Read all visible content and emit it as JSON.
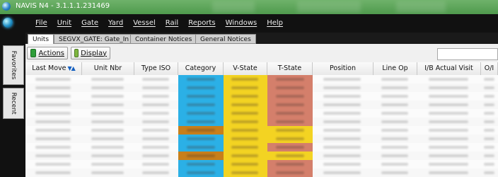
{
  "window": {
    "title": "NAVIS N4 - 3.1.1.1.231469"
  },
  "menu": [
    "File",
    "Unit",
    "Gate",
    "Yard",
    "Vessel",
    "Rail",
    "Reports",
    "Windows",
    "Help"
  ],
  "tabs": [
    "Units",
    "SEGVX_GATE: Gate_In",
    "Container Notices",
    "General Notices"
  ],
  "active_tab": "Units",
  "side_tabs": [
    "Favorites",
    "Recent"
  ],
  "toolbar": {
    "actions_label": "Actions",
    "display_label": "Display",
    "search_value": ""
  },
  "grid": {
    "columns": [
      "Last Move",
      "Unit Nbr",
      "Type ISO",
      "Category",
      "V-State",
      "T-State",
      "Position",
      "Line Op",
      "I/B Actual Visit",
      "O/I"
    ],
    "row_count": 12,
    "category_colors": [
      "#2bb0e6",
      "#2bb0e6",
      "#2bb0e6",
      "#2bb0e6",
      "#2bb0e6",
      "#2bb0e6",
      "#c87f1b",
      "#2bb0e6",
      "#2bb0e6",
      "#c87f1b",
      "#2bb0e6",
      "#2bb0e6"
    ],
    "vstate_colors": [
      "#f3d322",
      "#f3d322",
      "#f3d322",
      "#f3d322",
      "#f3d322",
      "#f3d322",
      "#f3d322",
      "#f3d322",
      "#f3d322",
      "#f3d322",
      "#f3d322",
      "#f3d322"
    ],
    "tstate_colors": [
      "#d47f6b",
      "#d47f6b",
      "#d47f6b",
      "#d47f6b",
      "#d47f6b",
      "#d47f6b",
      "#f3d322",
      "#f3d322",
      "#d47f6b",
      "#f3d322",
      "#d47f6b",
      "#d47f6b"
    ]
  }
}
